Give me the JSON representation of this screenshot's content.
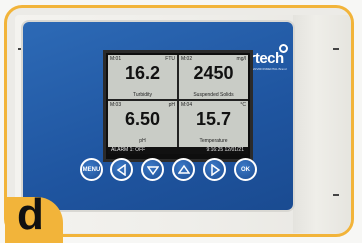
{
  "brand": {
    "name": "partech",
    "tagline": "an ENVIRONMENTAL Brand"
  },
  "display": {
    "cells": [
      {
        "channel": "M:01",
        "unit": "FTU",
        "value": "16.2",
        "parameter": "Turbidity"
      },
      {
        "channel": "M:02",
        "unit": "mg/l",
        "value": "2450",
        "parameter": "Suspended Solids"
      },
      {
        "channel": "M:03",
        "unit": "pH",
        "value": "6.50",
        "parameter": "pH"
      },
      {
        "channel": "M:04",
        "unit": "°C",
        "value": "15.7",
        "parameter": "Temperature"
      }
    ],
    "status": {
      "alarm": "ALARM 1: OFF",
      "datetime": "9:16:25 12/01/21"
    }
  },
  "buttons": {
    "menu": "MENU",
    "ok": "OK"
  },
  "badge": {
    "letter": "d"
  },
  "colors": {
    "accent": "#f2b43a",
    "panel": "#2360aa"
  }
}
